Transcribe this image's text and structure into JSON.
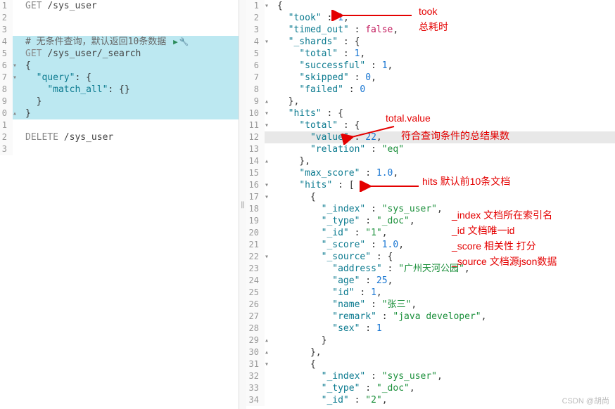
{
  "left": {
    "lines": [
      {
        "n": "1",
        "code": [
          {
            "t": "GET ",
            "c": "method"
          },
          {
            "t": "/sys_user",
            "c": "path"
          }
        ]
      },
      {
        "n": "2",
        "code": []
      },
      {
        "n": "3",
        "code": []
      },
      {
        "n": "4",
        "hl": true,
        "code": [
          {
            "t": "# 无条件查询，默认返回10条数据 ",
            "c": "comment"
          }
        ],
        "icons": true
      },
      {
        "n": "5",
        "hl": true,
        "code": [
          {
            "t": "GET ",
            "c": "method"
          },
          {
            "t": "/sys_user/_search",
            "c": "path"
          }
        ]
      },
      {
        "n": "6",
        "hl": true,
        "fold": "▼",
        "code": [
          {
            "t": "{",
            "c": "punct"
          }
        ]
      },
      {
        "n": "7",
        "hl": true,
        "fold": "▼",
        "code": [
          {
            "t": "  ",
            "c": ""
          },
          {
            "t": "\"query\"",
            "c": "key"
          },
          {
            "t": ": {",
            "c": "punct"
          }
        ]
      },
      {
        "n": "8",
        "hl": true,
        "code": [
          {
            "t": "    ",
            "c": ""
          },
          {
            "t": "\"match_all\"",
            "c": "key"
          },
          {
            "t": ": {}",
            "c": "punct"
          }
        ]
      },
      {
        "n": "9",
        "hl": true,
        "code": [
          {
            "t": "  }",
            "c": "punct"
          }
        ]
      },
      {
        "n": "0",
        "hl": true,
        "fold": "▲",
        "code": [
          {
            "t": "}",
            "c": "punct"
          }
        ]
      },
      {
        "n": "1",
        "code": []
      },
      {
        "n": "2",
        "code": [
          {
            "t": "DELETE ",
            "c": "method"
          },
          {
            "t": "/sys_user",
            "c": "path"
          }
        ]
      },
      {
        "n": "3",
        "code": []
      }
    ]
  },
  "right": {
    "lines": [
      {
        "n": "1",
        "fold": "▼",
        "code": [
          {
            "t": "{",
            "c": "punct"
          }
        ]
      },
      {
        "n": "2",
        "code": [
          {
            "t": "  ",
            "c": ""
          },
          {
            "t": "\"took\"",
            "c": "key"
          },
          {
            "t": " : ",
            "c": "punct"
          },
          {
            "t": "1",
            "c": "number"
          },
          {
            "t": ",",
            "c": "punct"
          }
        ]
      },
      {
        "n": "3",
        "code": [
          {
            "t": "  ",
            "c": ""
          },
          {
            "t": "\"timed_out\"",
            "c": "key"
          },
          {
            "t": " : ",
            "c": "punct"
          },
          {
            "t": "false",
            "c": "bool"
          },
          {
            "t": ",",
            "c": "punct"
          }
        ]
      },
      {
        "n": "4",
        "fold": "▼",
        "code": [
          {
            "t": "  ",
            "c": ""
          },
          {
            "t": "\"_shards\"",
            "c": "key"
          },
          {
            "t": " : {",
            "c": "punct"
          }
        ]
      },
      {
        "n": "5",
        "code": [
          {
            "t": "    ",
            "c": ""
          },
          {
            "t": "\"total\"",
            "c": "key"
          },
          {
            "t": " : ",
            "c": "punct"
          },
          {
            "t": "1",
            "c": "number"
          },
          {
            "t": ",",
            "c": "punct"
          }
        ]
      },
      {
        "n": "6",
        "code": [
          {
            "t": "    ",
            "c": ""
          },
          {
            "t": "\"successful\"",
            "c": "key"
          },
          {
            "t": " : ",
            "c": "punct"
          },
          {
            "t": "1",
            "c": "number"
          },
          {
            "t": ",",
            "c": "punct"
          }
        ]
      },
      {
        "n": "7",
        "code": [
          {
            "t": "    ",
            "c": ""
          },
          {
            "t": "\"skipped\"",
            "c": "key"
          },
          {
            "t": " : ",
            "c": "punct"
          },
          {
            "t": "0",
            "c": "number"
          },
          {
            "t": ",",
            "c": "punct"
          }
        ]
      },
      {
        "n": "8",
        "code": [
          {
            "t": "    ",
            "c": ""
          },
          {
            "t": "\"failed\"",
            "c": "key"
          },
          {
            "t": " : ",
            "c": "punct"
          },
          {
            "t": "0",
            "c": "number"
          }
        ]
      },
      {
        "n": "9",
        "fold": "▲",
        "code": [
          {
            "t": "  },",
            "c": "punct"
          }
        ]
      },
      {
        "n": "10",
        "fold": "▼",
        "code": [
          {
            "t": "  ",
            "c": ""
          },
          {
            "t": "\"hits\"",
            "c": "key"
          },
          {
            "t": " : {",
            "c": "punct"
          }
        ]
      },
      {
        "n": "11",
        "fold": "▼",
        "code": [
          {
            "t": "    ",
            "c": ""
          },
          {
            "t": "\"total\"",
            "c": "key"
          },
          {
            "t": " : {",
            "c": "punct"
          }
        ]
      },
      {
        "n": "12",
        "hl": true,
        "code": [
          {
            "t": "      ",
            "c": ""
          },
          {
            "t": "\"value\"",
            "c": "key"
          },
          {
            "t": " : ",
            "c": "punct"
          },
          {
            "t": "22",
            "c": "number"
          },
          {
            "t": ",",
            "c": "punct"
          }
        ]
      },
      {
        "n": "13",
        "code": [
          {
            "t": "      ",
            "c": ""
          },
          {
            "t": "\"relation\"",
            "c": "key"
          },
          {
            "t": " : ",
            "c": "punct"
          },
          {
            "t": "\"eq\"",
            "c": "string"
          }
        ]
      },
      {
        "n": "14",
        "fold": "▲",
        "code": [
          {
            "t": "    },",
            "c": "punct"
          }
        ]
      },
      {
        "n": "15",
        "code": [
          {
            "t": "    ",
            "c": ""
          },
          {
            "t": "\"max_score\"",
            "c": "key"
          },
          {
            "t": " : ",
            "c": "punct"
          },
          {
            "t": "1.0",
            "c": "number"
          },
          {
            "t": ",",
            "c": "punct"
          }
        ]
      },
      {
        "n": "16",
        "fold": "▼",
        "code": [
          {
            "t": "    ",
            "c": ""
          },
          {
            "t": "\"hits\"",
            "c": "key"
          },
          {
            "t": " : [",
            "c": "punct"
          }
        ]
      },
      {
        "n": "17",
        "fold": "▼",
        "code": [
          {
            "t": "      {",
            "c": "punct"
          }
        ]
      },
      {
        "n": "18",
        "code": [
          {
            "t": "        ",
            "c": ""
          },
          {
            "t": "\"_index\"",
            "c": "key"
          },
          {
            "t": " : ",
            "c": "punct"
          },
          {
            "t": "\"sys_user\"",
            "c": "string"
          },
          {
            "t": ",",
            "c": "punct"
          }
        ]
      },
      {
        "n": "19",
        "code": [
          {
            "t": "        ",
            "c": ""
          },
          {
            "t": "\"_type\"",
            "c": "key"
          },
          {
            "t": " : ",
            "c": "punct"
          },
          {
            "t": "\"_doc\"",
            "c": "string"
          },
          {
            "t": ",",
            "c": "punct"
          }
        ]
      },
      {
        "n": "20",
        "code": [
          {
            "t": "        ",
            "c": ""
          },
          {
            "t": "\"_id\"",
            "c": "key"
          },
          {
            "t": " : ",
            "c": "punct"
          },
          {
            "t": "\"1\"",
            "c": "string"
          },
          {
            "t": ",",
            "c": "punct"
          }
        ]
      },
      {
        "n": "21",
        "code": [
          {
            "t": "        ",
            "c": ""
          },
          {
            "t": "\"_score\"",
            "c": "key"
          },
          {
            "t": " : ",
            "c": "punct"
          },
          {
            "t": "1.0",
            "c": "number"
          },
          {
            "t": ",",
            "c": "punct"
          }
        ]
      },
      {
        "n": "22",
        "fold": "▼",
        "code": [
          {
            "t": "        ",
            "c": ""
          },
          {
            "t": "\"_source\"",
            "c": "key"
          },
          {
            "t": " : {",
            "c": "punct"
          }
        ]
      },
      {
        "n": "23",
        "code": [
          {
            "t": "          ",
            "c": ""
          },
          {
            "t": "\"address\"",
            "c": "key"
          },
          {
            "t": " : ",
            "c": "punct"
          },
          {
            "t": "\"广州天河公园\"",
            "c": "string"
          },
          {
            "t": ",",
            "c": "punct"
          }
        ]
      },
      {
        "n": "24",
        "code": [
          {
            "t": "          ",
            "c": ""
          },
          {
            "t": "\"age\"",
            "c": "key"
          },
          {
            "t": " : ",
            "c": "punct"
          },
          {
            "t": "25",
            "c": "number"
          },
          {
            "t": ",",
            "c": "punct"
          }
        ]
      },
      {
        "n": "25",
        "code": [
          {
            "t": "          ",
            "c": ""
          },
          {
            "t": "\"id\"",
            "c": "key"
          },
          {
            "t": " : ",
            "c": "punct"
          },
          {
            "t": "1",
            "c": "number"
          },
          {
            "t": ",",
            "c": "punct"
          }
        ]
      },
      {
        "n": "26",
        "code": [
          {
            "t": "          ",
            "c": ""
          },
          {
            "t": "\"name\"",
            "c": "key"
          },
          {
            "t": " : ",
            "c": "punct"
          },
          {
            "t": "\"张三\"",
            "c": "string"
          },
          {
            "t": ",",
            "c": "punct"
          }
        ]
      },
      {
        "n": "27",
        "code": [
          {
            "t": "          ",
            "c": ""
          },
          {
            "t": "\"remark\"",
            "c": "key"
          },
          {
            "t": " : ",
            "c": "punct"
          },
          {
            "t": "\"java developer\"",
            "c": "string"
          },
          {
            "t": ",",
            "c": "punct"
          }
        ]
      },
      {
        "n": "28",
        "code": [
          {
            "t": "          ",
            "c": ""
          },
          {
            "t": "\"sex\"",
            "c": "key"
          },
          {
            "t": " : ",
            "c": "punct"
          },
          {
            "t": "1",
            "c": "number"
          }
        ]
      },
      {
        "n": "29",
        "fold": "▲",
        "code": [
          {
            "t": "        }",
            "c": "punct"
          }
        ]
      },
      {
        "n": "30",
        "fold": "▲",
        "code": [
          {
            "t": "      },",
            "c": "punct"
          }
        ]
      },
      {
        "n": "31",
        "fold": "▼",
        "code": [
          {
            "t": "      {",
            "c": "punct"
          }
        ]
      },
      {
        "n": "32",
        "code": [
          {
            "t": "        ",
            "c": ""
          },
          {
            "t": "\"_index\"",
            "c": "key"
          },
          {
            "t": " : ",
            "c": "punct"
          },
          {
            "t": "\"sys_user\"",
            "c": "string"
          },
          {
            "t": ",",
            "c": "punct"
          }
        ]
      },
      {
        "n": "33",
        "code": [
          {
            "t": "        ",
            "c": ""
          },
          {
            "t": "\"_type\"",
            "c": "key"
          },
          {
            "t": " : ",
            "c": "punct"
          },
          {
            "t": "\"_doc\"",
            "c": "string"
          },
          {
            "t": ",",
            "c": "punct"
          }
        ]
      },
      {
        "n": "34",
        "code": [
          {
            "t": "        ",
            "c": ""
          },
          {
            "t": "\"_id\"",
            "c": "key"
          },
          {
            "t": " : ",
            "c": "punct"
          },
          {
            "t": "\"2\"",
            "c": "string"
          },
          {
            "t": ",",
            "c": "punct"
          }
        ]
      }
    ]
  },
  "annotations": {
    "took_label": "took",
    "took_desc": "总耗时",
    "total_label": "total.value",
    "total_desc": "符合查询条件的总结果数",
    "hits_label": "hits 默认前10条文档",
    "index_label": "_index 文档所在索引名",
    "id_label": "_id 文档唯一id",
    "score_label": "_score 相关性 打分",
    "source_label": "_source 文档源json数据"
  },
  "watermark": "CSDN @胡尚"
}
